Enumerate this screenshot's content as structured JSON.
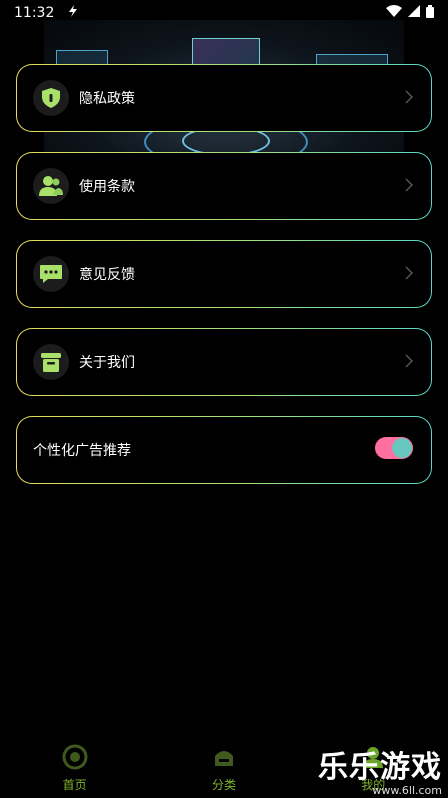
{
  "status_bar": {
    "time": "11:32"
  },
  "menu": {
    "items": [
      {
        "label": "隐私政策",
        "icon": "shield-icon"
      },
      {
        "label": "使用条款",
        "icon": "users-icon"
      },
      {
        "label": "意见反馈",
        "icon": "chat-icon"
      },
      {
        "label": "关于我们",
        "icon": "info-box-icon"
      }
    ],
    "personalized_ads": {
      "label": "个性化广告推荐",
      "enabled": true
    }
  },
  "tabbar": {
    "tabs": [
      {
        "label": "首页",
        "icon": "home-icon"
      },
      {
        "label": "分类",
        "icon": "gamepad-icon"
      },
      {
        "label": "我的",
        "icon": "profile-icon"
      }
    ]
  },
  "watermark": {
    "title": "乐乐游戏",
    "url": "www.6ll.com"
  },
  "colors": {
    "border_start": "#e6df5a",
    "border_end": "#57d6c4",
    "icon_green": "#a8e06a",
    "toggle_track": "#ff6f9f",
    "toggle_knob": "#67c8c0",
    "tab_label": "#7fb42a"
  }
}
